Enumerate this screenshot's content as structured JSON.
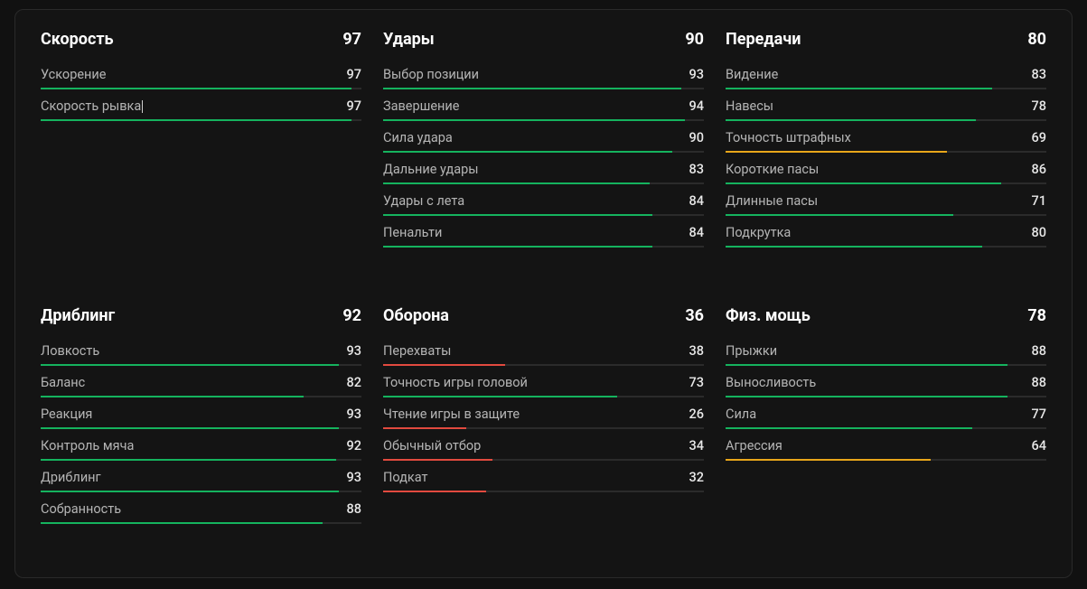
{
  "colors": {
    "green": "#15b35e",
    "yellow": "#e8a61a",
    "red": "#e24a3f"
  },
  "cursor_on": "speed.1",
  "groups": [
    {
      "id": "speed",
      "title": "Скорость",
      "value": 97,
      "stats": [
        {
          "label": "Ускорение",
          "value": 97
        },
        {
          "label": "Скорость рывка",
          "value": 97
        }
      ]
    },
    {
      "id": "shooting",
      "title": "Удары",
      "value": 90,
      "stats": [
        {
          "label": "Выбор позиции",
          "value": 93
        },
        {
          "label": "Завершение",
          "value": 94
        },
        {
          "label": "Сила удара",
          "value": 90
        },
        {
          "label": "Дальние удары",
          "value": 83
        },
        {
          "label": "Удары с лета",
          "value": 84
        },
        {
          "label": "Пенальти",
          "value": 84
        }
      ]
    },
    {
      "id": "passing",
      "title": "Передачи",
      "value": 80,
      "stats": [
        {
          "label": "Видение",
          "value": 83
        },
        {
          "label": "Навесы",
          "value": 78
        },
        {
          "label": "Точность штрафных",
          "value": 69
        },
        {
          "label": "Короткие пасы",
          "value": 86
        },
        {
          "label": "Длинные пасы",
          "value": 71
        },
        {
          "label": "Подкрутка",
          "value": 80
        }
      ]
    },
    {
      "id": "dribbling",
      "title": "Дриблинг",
      "value": 92,
      "stats": [
        {
          "label": "Ловкость",
          "value": 93
        },
        {
          "label": "Баланс",
          "value": 82
        },
        {
          "label": "Реакция",
          "value": 93
        },
        {
          "label": "Контроль мяча",
          "value": 92
        },
        {
          "label": "Дриблинг",
          "value": 93
        },
        {
          "label": "Собранность",
          "value": 88
        }
      ]
    },
    {
      "id": "defense",
      "title": "Оборона",
      "value": 36,
      "stats": [
        {
          "label": "Перехваты",
          "value": 38
        },
        {
          "label": "Точность игры головой",
          "value": 73
        },
        {
          "label": "Чтение игры в защите",
          "value": 26
        },
        {
          "label": "Обычный отбор",
          "value": 34
        },
        {
          "label": "Подкат",
          "value": 32
        }
      ]
    },
    {
      "id": "physical",
      "title": "Физ. мощь",
      "value": 78,
      "stats": [
        {
          "label": "Прыжки",
          "value": 88
        },
        {
          "label": "Выносливость",
          "value": 88
        },
        {
          "label": "Сила",
          "value": 77
        },
        {
          "label": "Агрессия",
          "value": 64
        }
      ]
    }
  ]
}
